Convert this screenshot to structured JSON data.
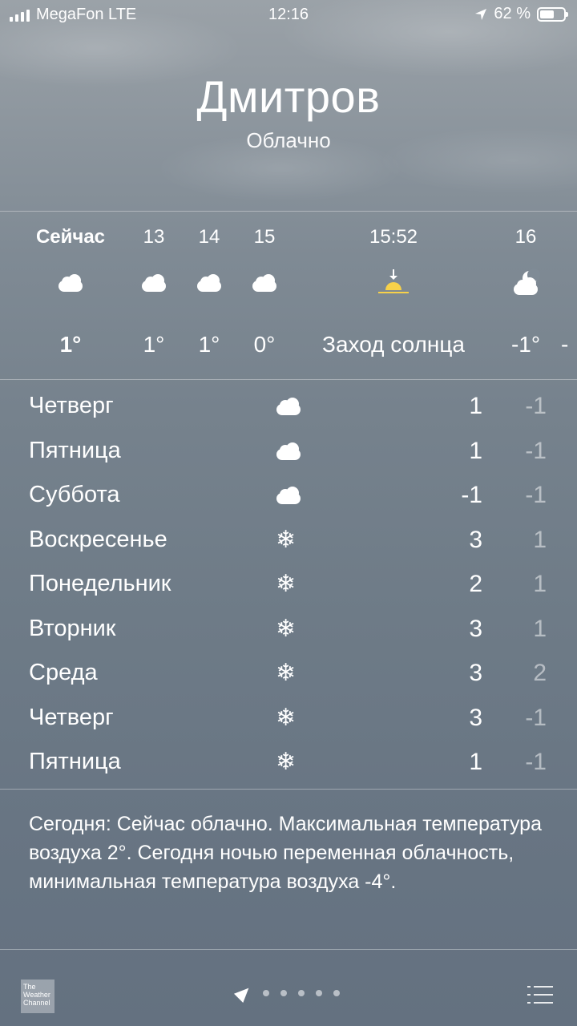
{
  "status_bar": {
    "carrier": "MegaFon LTE",
    "time": "12:16",
    "battery_percent": "62 %",
    "battery_level": 0.62
  },
  "location": {
    "city": "Дмитров",
    "condition": "Облачно"
  },
  "hourly": [
    {
      "label": "Сейчас",
      "icon": "cloud-icon",
      "temp": "1°"
    },
    {
      "label": "13",
      "icon": "cloud-icon",
      "temp": "1°"
    },
    {
      "label": "14",
      "icon": "cloud-icon",
      "temp": "1°"
    },
    {
      "label": "15",
      "icon": "cloud-icon",
      "temp": "0°"
    },
    {
      "label": "15:52",
      "icon": "sunset-icon",
      "temp": "Заход солнца"
    },
    {
      "label": "16",
      "icon": "moon-cloud-icon",
      "temp": "-1°"
    }
  ],
  "daily": [
    {
      "day": "Четверг",
      "icon": "cloud-icon",
      "max": "1",
      "min": "-1"
    },
    {
      "day": "Пятница",
      "icon": "cloud-icon",
      "max": "1",
      "min": "-1"
    },
    {
      "day": "Суббота",
      "icon": "cloud-icon",
      "max": "-1",
      "min": "-1"
    },
    {
      "day": "Воскресенье",
      "icon": "snowflake-icon",
      "max": "3",
      "min": "1"
    },
    {
      "day": "Понедельник",
      "icon": "snowflake-icon",
      "max": "2",
      "min": "1"
    },
    {
      "day": "Вторник",
      "icon": "snowflake-icon",
      "max": "3",
      "min": "1"
    },
    {
      "day": "Среда",
      "icon": "snowflake-icon",
      "max": "3",
      "min": "2"
    },
    {
      "day": "Четверг",
      "icon": "snowflake-icon",
      "max": "3",
      "min": "-1"
    },
    {
      "day": "Пятница",
      "icon": "snowflake-icon",
      "max": "1",
      "min": "-1"
    }
  ],
  "summary": "Сегодня: Сейчас облачно. Максимальная температура воздуха 2°. Сегодня ночью переменная облачность, минимальная температура воздуха -4°.",
  "toolbar": {
    "logo_text": "The Weather Channel",
    "page_dots": 5
  },
  "colors": {
    "sun": "#f7d14a",
    "text": "#ffffff"
  }
}
